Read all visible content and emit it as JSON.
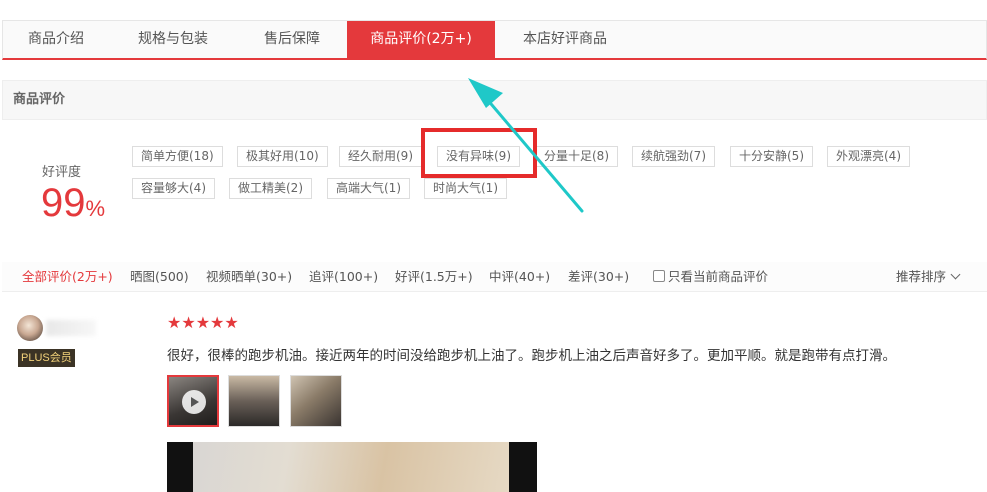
{
  "tabs": [
    {
      "label": "商品介绍",
      "active": false
    },
    {
      "label": "规格与包装",
      "active": false
    },
    {
      "label": "售后保障",
      "active": false
    },
    {
      "label": "商品评价(2万+)",
      "active": true
    },
    {
      "label": "本店好评商品",
      "active": false
    }
  ],
  "section_title": "商品评价",
  "good_rate": {
    "label": "好评度",
    "value": "99",
    "unit": "%"
  },
  "tags": [
    "简单方便(18)",
    "极其好用(10)",
    "经久耐用(9)",
    "没有异味(9)",
    "分量十足(8)",
    "续航强劲(7)",
    "十分安静(5)",
    "外观漂亮(4)",
    "容量够大(4)",
    "做工精美(2)",
    "高端大气(1)",
    "时尚大气(1)"
  ],
  "highlighted_tag": "没有异味(9)",
  "filters": [
    {
      "label": "全部评价(2万+)",
      "active": true
    },
    {
      "label": "晒图(500)",
      "active": false
    },
    {
      "label": "视频晒单(30+)",
      "active": false
    },
    {
      "label": "追评(100+)",
      "active": false
    },
    {
      "label": "好评(1.5万+)",
      "active": false
    },
    {
      "label": "中评(40+)",
      "active": false
    },
    {
      "label": "差评(30+)",
      "active": false
    }
  ],
  "only_current_label": "只看当前商品评价",
  "sort_label": "推荐排序",
  "review": {
    "badge": "PLUS会员",
    "stars": "★★★★★",
    "rating": 5,
    "text": "很好，很棒的跑步机油。接近两年的时间没给跑步机上油了。跑步机上油之后声音好多了。更加平顺。就是跑带有点打滑。"
  },
  "colors": {
    "accent": "#e4393c",
    "arrow": "#1fc8c8",
    "highlight": "#e52b2b"
  }
}
